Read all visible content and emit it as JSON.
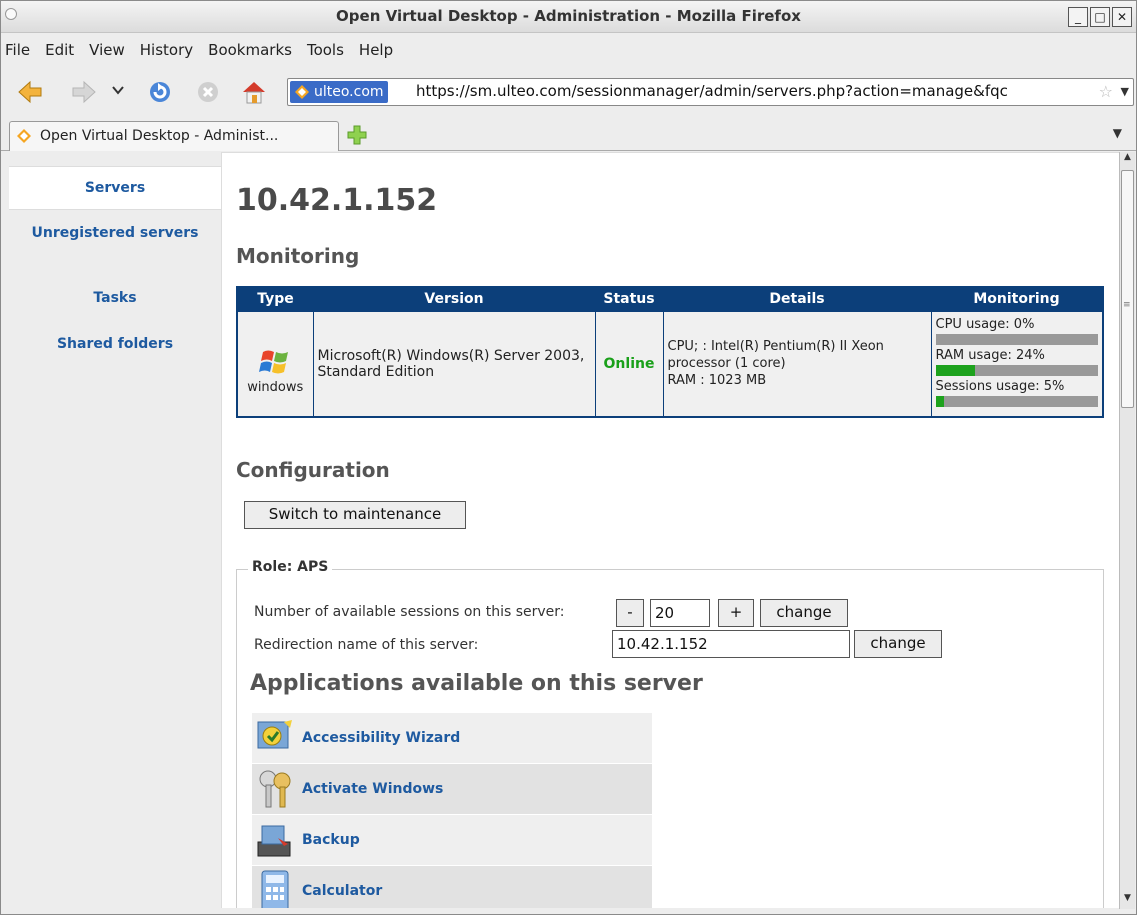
{
  "window": {
    "title": "Open Virtual Desktop - Administration - Mozilla Firefox"
  },
  "menu": [
    "File",
    "Edit",
    "View",
    "History",
    "Bookmarks",
    "Tools",
    "Help"
  ],
  "toolbar": {
    "site_label": "ulteo.com",
    "url": "https://sm.ulteo.com/sessionmanager/admin/servers.php?action=manage&fqc"
  },
  "tab": {
    "label": "Open Virtual Desktop - Administ..."
  },
  "sidebar": {
    "items": [
      {
        "label": "Servers"
      },
      {
        "label": "Unregistered servers"
      },
      {
        "label": "Tasks"
      },
      {
        "label": "Shared folders"
      }
    ]
  },
  "page": {
    "host": "10.42.1.152",
    "monitoring_heading": "Monitoring",
    "configuration_heading": "Configuration",
    "maintenance_button": "Switch to maintenance",
    "apps_heading": "Applications available on this server"
  },
  "monitoring_table": {
    "headers": [
      "Type",
      "Version",
      "Status",
      "Details",
      "Monitoring"
    ],
    "row": {
      "type_label": "windows",
      "version": "Microsoft(R) Windows(R) Server 2003, Standard Edition",
      "status": "Online",
      "details_line1": "CPU; : Intel(R) Pentium(R) II Xeon processor (1 core)",
      "details_line2": "RAM : 1023 MB",
      "cpu_label": "CPU usage: 0%",
      "ram_label": "RAM usage: 24%",
      "sessions_label": "Sessions usage: 5%",
      "cpu_pct": 0,
      "ram_pct": 24,
      "sessions_pct": 5
    }
  },
  "role": {
    "legend": "Role: APS",
    "sessions_label": "Number of available sessions on this server:",
    "minus": "-",
    "sessions_value": "20",
    "plus": "+",
    "change": "change",
    "redirection_label": "Redirection name of this server:",
    "redirection_value": "10.42.1.152"
  },
  "apps": [
    {
      "label": "Accessibility Wizard"
    },
    {
      "label": "Activate Windows"
    },
    {
      "label": "Backup"
    },
    {
      "label": "Calculator"
    }
  ],
  "colors": {
    "header_blue": "#0c3f7a",
    "link_blue": "#1e5aa0",
    "online_green": "#1aa01a",
    "bar_green": "#1da21d"
  }
}
